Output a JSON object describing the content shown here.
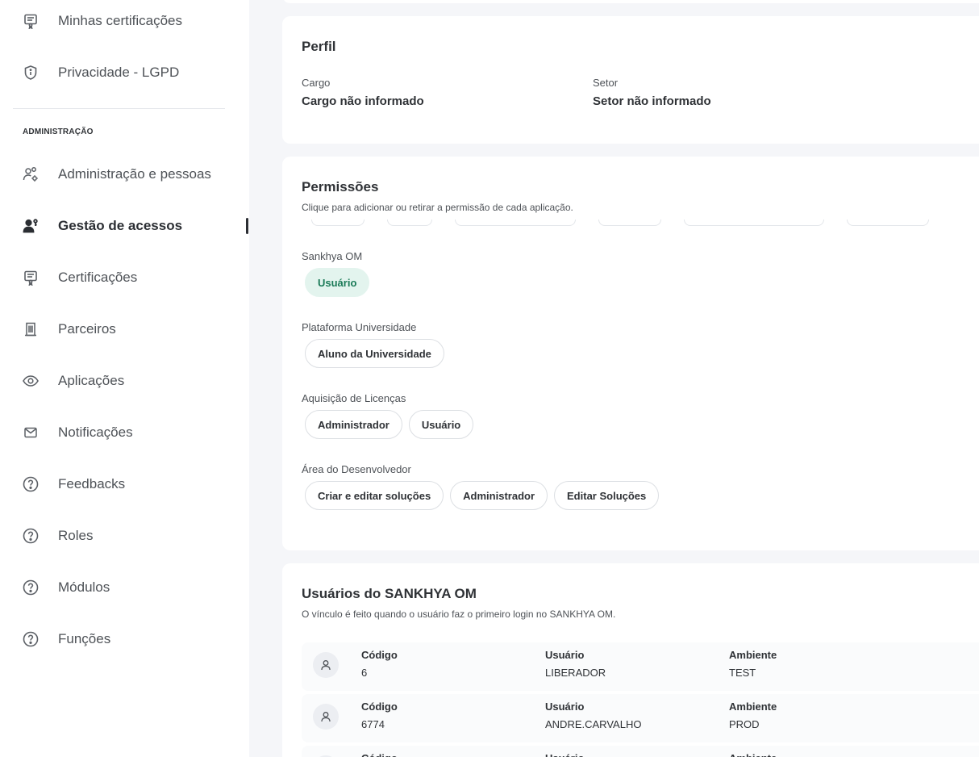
{
  "sidebar": {
    "top_items": [
      {
        "label": "Minhas certificações",
        "icon": "certificate-icon"
      },
      {
        "label": "Privacidade - LGPD",
        "icon": "shield-icon"
      }
    ],
    "admin_section_title": "ADMINISTRAÇÃO",
    "admin_items": [
      {
        "label": "Administração e pessoas",
        "icon": "users-gear-icon"
      },
      {
        "label": "Gestão de acessos",
        "icon": "user-key-icon",
        "active": true
      },
      {
        "label": "Certificações",
        "icon": "certificate-icon"
      },
      {
        "label": "Parceiros",
        "icon": "building-icon"
      },
      {
        "label": "Aplicações",
        "icon": "eye-icon"
      },
      {
        "label": "Notificações",
        "icon": "mail-icon"
      },
      {
        "label": "Feedbacks",
        "icon": "help-circle-icon"
      },
      {
        "label": "Roles",
        "icon": "help-circle-icon"
      },
      {
        "label": "Módulos",
        "icon": "help-circle-icon"
      },
      {
        "label": "Funções",
        "icon": "help-circle-icon"
      }
    ]
  },
  "profile": {
    "title": "Perfil",
    "cargo_label": "Cargo",
    "cargo_value": "Cargo não informado",
    "setor_label": "Setor",
    "setor_value": "Setor não informado"
  },
  "permissions": {
    "title": "Permissões",
    "subtitle": "Clique para adicionar ou retirar a permissão de cada aplicação.",
    "groups": [
      {
        "name": "Sankhya OM",
        "chips": [
          {
            "label": "Usuário",
            "selected": true
          }
        ]
      },
      {
        "name": "Plataforma Universidade",
        "chips": [
          {
            "label": "Aluno da Universidade",
            "selected": false
          }
        ]
      },
      {
        "name": "Aquisição de Licenças",
        "chips": [
          {
            "label": "Administrador",
            "selected": false
          },
          {
            "label": "Usuário",
            "selected": false
          }
        ]
      },
      {
        "name": "Área do Desenvolvedor",
        "chips": [
          {
            "label": "Criar e editar soluções",
            "selected": false
          },
          {
            "label": "Administrador",
            "selected": false
          },
          {
            "label": "Editar Soluções",
            "selected": false
          }
        ]
      }
    ]
  },
  "users": {
    "title": "Usuários do SANKHYA OM",
    "subtitle": "O vínculo é feito quando o usuário faz o primeiro login no SANKHYA OM.",
    "col_code": "Código",
    "col_user": "Usuário",
    "col_env": "Ambiente",
    "rows": [
      {
        "code": "6",
        "user": "LIBERADOR",
        "env": "TEST"
      },
      {
        "code": "6774",
        "user": "ANDRE.CARVALHO",
        "env": "PROD"
      },
      {
        "code": "",
        "user": "",
        "env": ""
      }
    ]
  },
  "colors": {
    "selected_chip_bg": "#e3f4ee",
    "selected_chip_text": "#1a7a57",
    "page_bg": "#f5f6f9"
  }
}
